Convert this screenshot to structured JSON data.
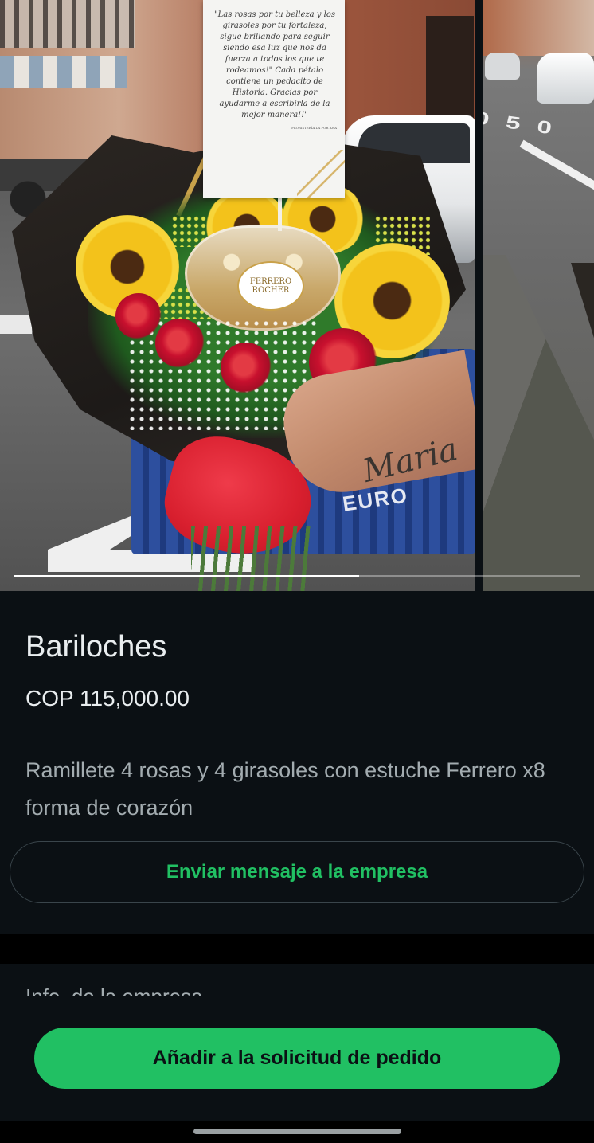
{
  "carousel": {
    "card": {
      "text": "\"Las rosas por tu belleza y los girasoles por tu fortaleza, sigue brillando para seguir siendo esa luz que nos da fuerza a todos los que te rodeamos!\" Cada pétalo contiene un pedacito de Historia. Gracias por ayudarme a escribirla de la mejor manera!!\"",
      "signature": "FLORISTERÍA LA FOR ANA"
    },
    "ferrero_label": "FERRERO ROCHER",
    "crate_text": "EURO",
    "tattoo_text": "Maria",
    "next_slide_road_text": "0 5 0",
    "progress": 0.61
  },
  "product": {
    "name": "Bariloches",
    "price": "COP 115,000.00",
    "description": "Ramillete 4 rosas y 4 girasoles con estuche Ferrero x8 forma de corazón"
  },
  "actions": {
    "message_business": "Enviar mensaje a la empresa",
    "add_to_order": "Añadir a la solicitud de pedido"
  },
  "info": {
    "heading": "Info. de la empresa"
  },
  "colors": {
    "background": "#0b1014",
    "accent": "#21c063",
    "text_primary": "#e9edef",
    "text_secondary": "#a3acb0"
  }
}
